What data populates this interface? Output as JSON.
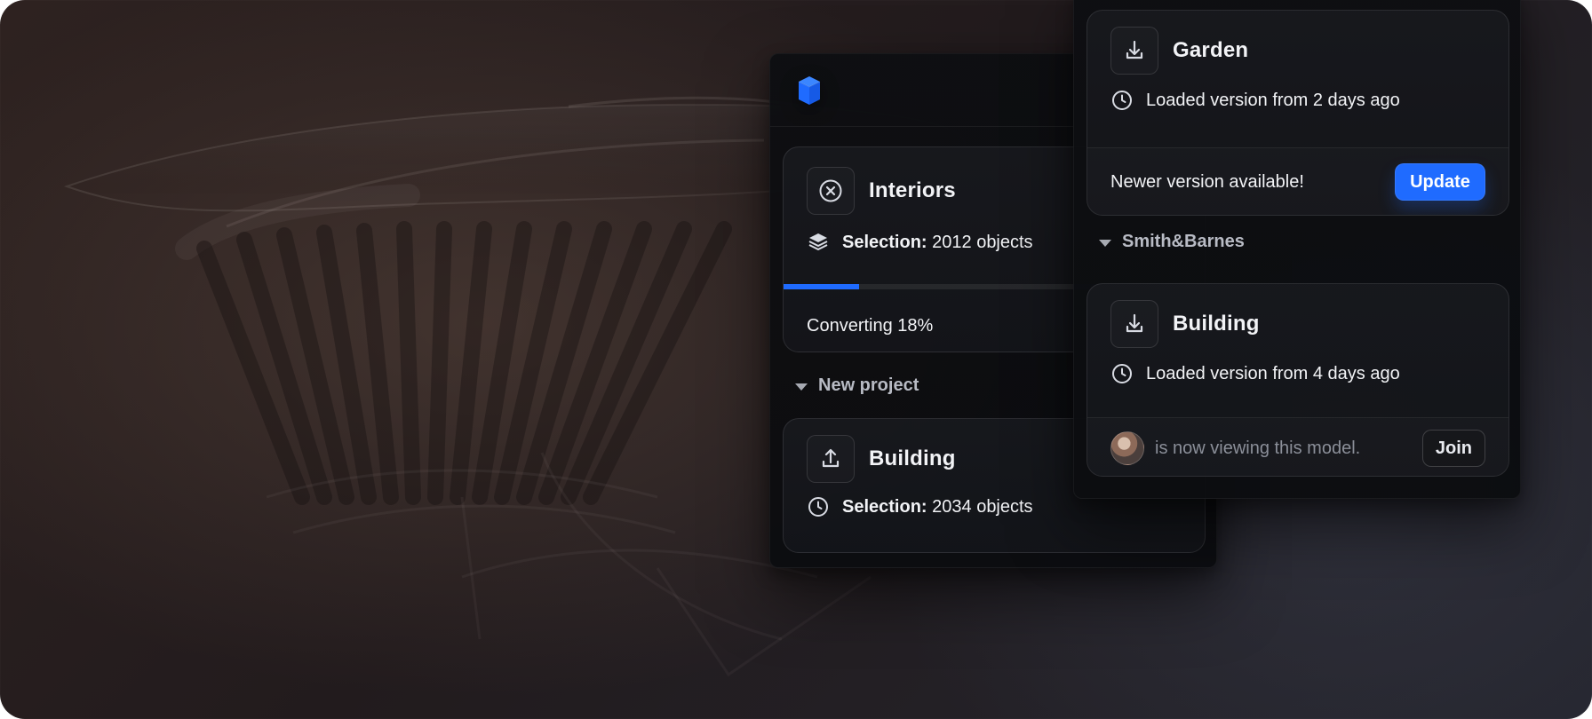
{
  "colors": {
    "accent": "#1f6bff",
    "cube": "#1f6bff"
  },
  "left_panel": {
    "card_interiors": {
      "title": "Interiors",
      "icon": "close-icon",
      "selection_label": "Selection:",
      "selection_value": "2012 objects",
      "progress_percent": 18,
      "progress_text": "Converting 18%"
    },
    "section_new_project": {
      "label": "New project"
    },
    "card_building": {
      "title": "Building",
      "icon": "upload-icon",
      "selection_label": "Selection:",
      "selection_value": "2034 objects"
    }
  },
  "right_panel": {
    "card_garden": {
      "title": "Garden",
      "icon": "download-icon",
      "loaded_text": "Loaded version from 2 days ago",
      "newer_text": "Newer version available!",
      "update_label": "Update"
    },
    "section_smith": {
      "label": "Smith&Barnes"
    },
    "card_building": {
      "title": "Building",
      "icon": "download-icon",
      "loaded_text": "Loaded version from 4 days ago",
      "viewer_text": "is now viewing this model.",
      "join_label": "Join"
    }
  }
}
